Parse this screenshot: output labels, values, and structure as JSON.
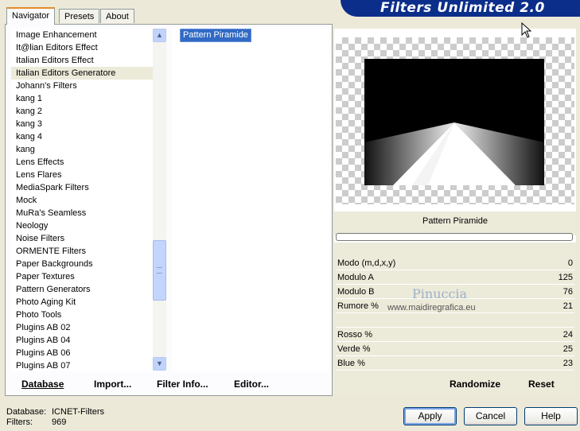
{
  "tabs": [
    {
      "label": "Navigator",
      "active": true
    },
    {
      "label": "Presets",
      "active": false
    },
    {
      "label": "About",
      "active": false
    }
  ],
  "banner": {
    "title": "Filters Unlimited 2.0",
    "color": "#0b2e8a"
  },
  "categories": [
    {
      "label": "Image Enhancement"
    },
    {
      "label": "It@lian Editors Effect"
    },
    {
      "label": "Italian Editors Effect"
    },
    {
      "label": "Italian Editors Generatore",
      "selected": true
    },
    {
      "label": "Johann's Filters"
    },
    {
      "label": "kang 1"
    },
    {
      "label": "kang 2"
    },
    {
      "label": "kang 3"
    },
    {
      "label": "kang 4"
    },
    {
      "label": "kang"
    },
    {
      "label": "Lens Effects"
    },
    {
      "label": "Lens Flares"
    },
    {
      "label": "MediaSpark Filters"
    },
    {
      "label": "Mock"
    },
    {
      "label": "MuRa's Seamless"
    },
    {
      "label": "Neology"
    },
    {
      "label": "Noise Filters"
    },
    {
      "label": "ORMENTE Filters"
    },
    {
      "label": "Paper Backgrounds"
    },
    {
      "label": "Paper Textures"
    },
    {
      "label": "Pattern Generators"
    },
    {
      "label": "Photo Aging Kit"
    },
    {
      "label": "Photo Tools"
    },
    {
      "label": "Plugins AB 02"
    },
    {
      "label": "Plugins AB 04"
    },
    {
      "label": "Plugins AB 06"
    },
    {
      "label": "Plugins AB 07"
    }
  ],
  "filters": {
    "selected": "Pattern Piramide"
  },
  "panel_buttons": {
    "database": "Database",
    "import": "Import...",
    "filter_info": "Filter Info...",
    "editor": "Editor..."
  },
  "preview": {
    "filter_name": "Pattern Piramide"
  },
  "params": [
    {
      "label": "Modo (m,d,x,y)",
      "value": "0"
    },
    {
      "label": "Modulo A",
      "value": "125"
    },
    {
      "label": "Modulo B",
      "value": "76"
    },
    {
      "label": "Rumore %",
      "value": "21"
    },
    {
      "label": "",
      "value": ""
    },
    {
      "label": "Rosso %",
      "value": "24"
    },
    {
      "label": "Verde %",
      "value": "25"
    },
    {
      "label": "Blue %",
      "value": "23"
    }
  ],
  "watermark": {
    "name": "Pinuccia",
    "site": "www.maidiregrafica.eu"
  },
  "actions": {
    "randomize": "Randomize",
    "reset": "Reset"
  },
  "status": {
    "database_label": "Database:",
    "database_value": "ICNET-Filters",
    "filters_label": "Filters:",
    "filters_value": "969"
  },
  "dialog_buttons": {
    "apply": "Apply",
    "cancel": "Cancel",
    "help": "Help"
  }
}
